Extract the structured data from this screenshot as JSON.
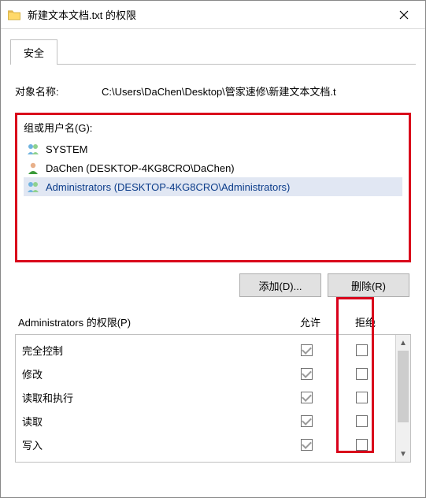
{
  "window": {
    "title": "新建文本文档.txt 的权限"
  },
  "tabs": {
    "security": "安全"
  },
  "object": {
    "label": "对象名称:",
    "value": "C:\\Users\\DaChen\\Desktop\\管家速修\\新建文本文档.t"
  },
  "groups": {
    "label": "组或用户名(G):",
    "items": [
      {
        "name": "SYSTEM",
        "type": "group"
      },
      {
        "name": "DaChen (DESKTOP-4KG8CRO\\DaChen)",
        "type": "user"
      },
      {
        "name": "Administrators (DESKTOP-4KG8CRO\\Administrators)",
        "type": "group"
      }
    ]
  },
  "buttons": {
    "add": "添加(D)...",
    "remove": "删除(R)"
  },
  "perms": {
    "heading": "Administrators 的权限(P)",
    "col_allow": "允许",
    "col_deny": "拒绝",
    "rows": [
      {
        "name": "完全控制",
        "allow": true,
        "deny": false
      },
      {
        "name": "修改",
        "allow": true,
        "deny": false
      },
      {
        "name": "读取和执行",
        "allow": true,
        "deny": false
      },
      {
        "name": "读取",
        "allow": true,
        "deny": false
      },
      {
        "name": "写入",
        "allow": true,
        "deny": false
      }
    ]
  }
}
